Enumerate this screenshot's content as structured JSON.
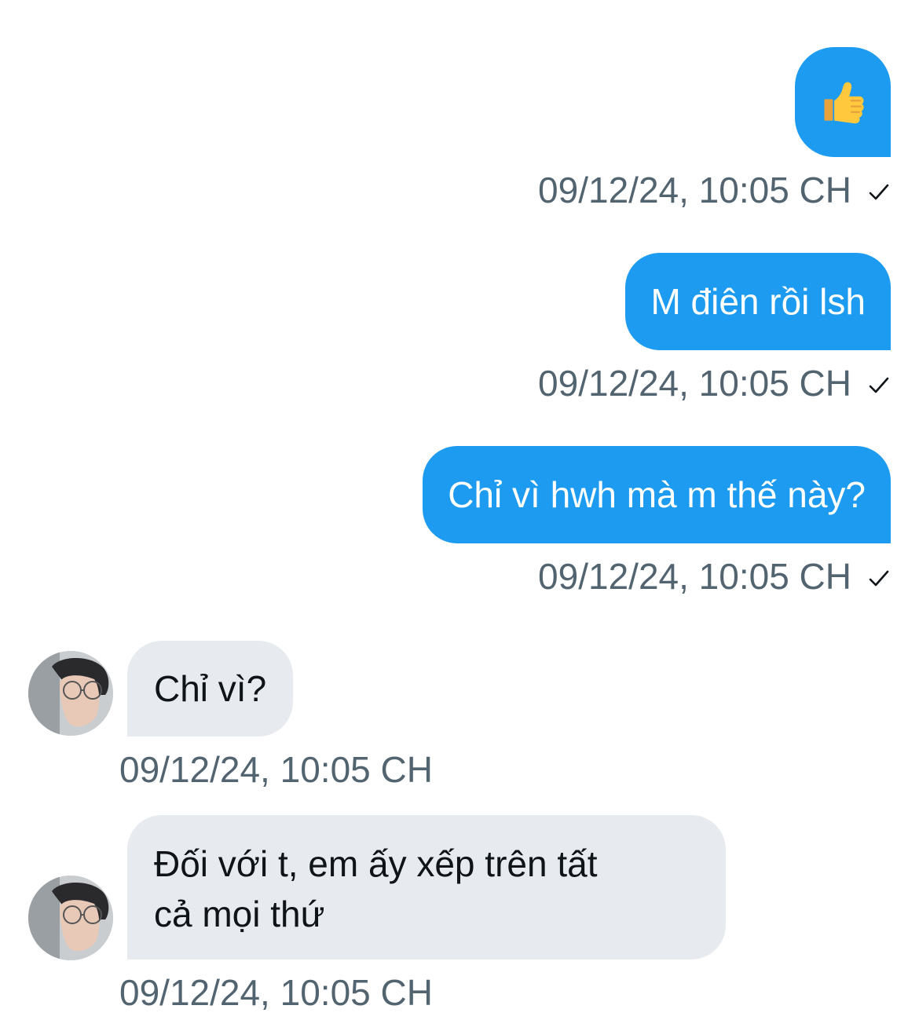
{
  "conversation": {
    "messages": [
      {
        "direction": "sent",
        "type": "emoji",
        "content": "👍",
        "emoji_icon": "thumbs-up-icon",
        "timestamp": "09/12/24, 10:05 CH",
        "status_icon": "check-icon"
      },
      {
        "direction": "sent",
        "type": "text",
        "content": "M điên rồi lsh",
        "timestamp": "09/12/24, 10:05 CH",
        "status_icon": "check-icon"
      },
      {
        "direction": "sent",
        "type": "text",
        "content": "Chỉ vì hwh mà m thế này?",
        "timestamp": "09/12/24, 10:05 CH",
        "status_icon": "check-icon"
      },
      {
        "direction": "received",
        "type": "text",
        "content": "Chỉ vì?",
        "timestamp": "09/12/24, 10:05 CH"
      },
      {
        "direction": "received",
        "type": "text",
        "lines": [
          "Đối với t, em ấy xếp trên tất",
          "cả mọi thứ"
        ],
        "timestamp": "09/12/24, 10:05 CH"
      }
    ]
  },
  "colors": {
    "sent_bubble": "#1d9bf0",
    "received_bubble": "#e7ebef",
    "timestamp": "#536471",
    "background": "#ffffff"
  }
}
